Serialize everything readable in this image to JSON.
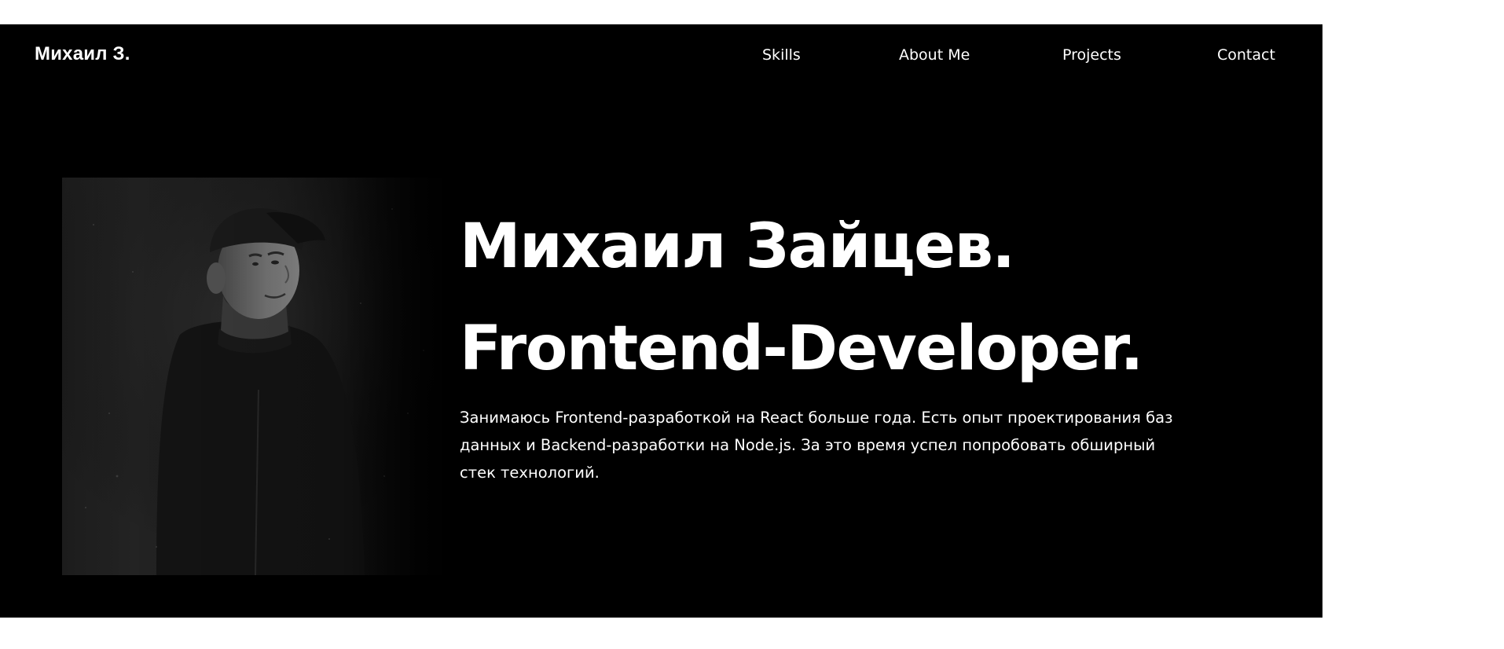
{
  "header": {
    "logo": "Михаил З."
  },
  "nav": {
    "items": [
      {
        "label": "Skills"
      },
      {
        "label": "About Me"
      },
      {
        "label": "Projects"
      },
      {
        "label": "Contact"
      }
    ]
  },
  "hero": {
    "title_line1": "Михаил Зайцев.",
    "title_line2": "Frontend-Developer.",
    "bio": "Занимаюсь Frontend-разработкой на React больше года. Есть опыт проектирования баз данных и Backend-разработки на Node.js. За это время успел попробовать обширный стек технологий.",
    "photo_icon": "portrait-photo"
  },
  "colors": {
    "page_background": "#ffffff",
    "hero_background": "#000000",
    "text": "#ffffff"
  }
}
